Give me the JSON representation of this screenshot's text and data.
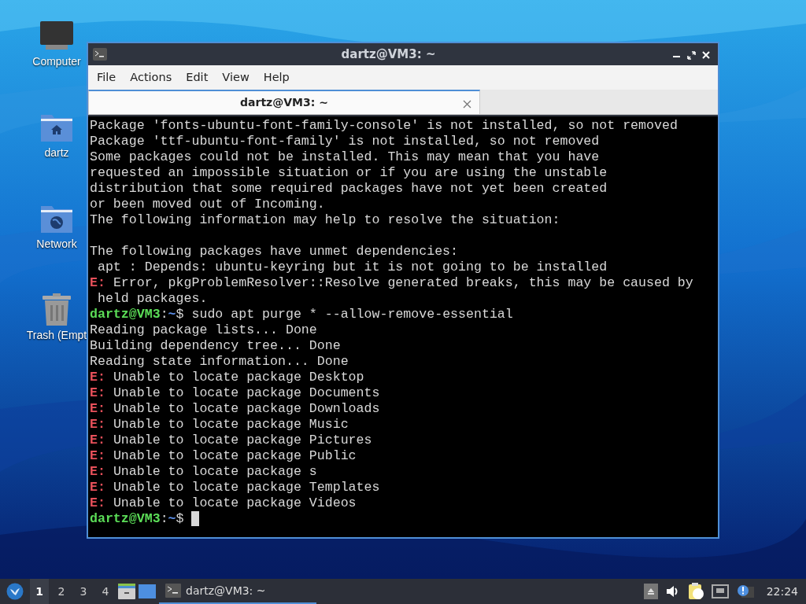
{
  "desktop": {
    "icons": [
      {
        "label": "Computer",
        "kind": "computer"
      },
      {
        "label": "dartz",
        "kind": "home"
      },
      {
        "label": "Network",
        "kind": "network"
      },
      {
        "label": "Trash (Empt",
        "kind": "trash"
      }
    ]
  },
  "window": {
    "title": "dartz@VM3: ~",
    "menu": [
      "File",
      "Actions",
      "Edit",
      "View",
      "Help"
    ],
    "tabs": [
      {
        "label": "dartz@VM3: ~",
        "selected": true
      }
    ],
    "terminal": {
      "lines": [
        {
          "kind": "text",
          "text": "Package 'fonts-ubuntu-font-family-console' is not installed, so not removed"
        },
        {
          "kind": "text",
          "text": "Package 'ttf-ubuntu-font-family' is not installed, so not removed"
        },
        {
          "kind": "text",
          "text": "Some packages could not be installed. This may mean that you have"
        },
        {
          "kind": "text",
          "text": "requested an impossible situation or if you are using the unstable"
        },
        {
          "kind": "text",
          "text": "distribution that some required packages have not yet been created"
        },
        {
          "kind": "text",
          "text": "or been moved out of Incoming."
        },
        {
          "kind": "text",
          "text": "The following information may help to resolve the situation:"
        },
        {
          "kind": "blank"
        },
        {
          "kind": "text",
          "text": "The following packages have unmet dependencies:"
        },
        {
          "kind": "text",
          "text": " apt : Depends: ubuntu-keyring but it is not going to be installed"
        },
        {
          "kind": "error",
          "prefix": "E:",
          "text": " Error, pkgProblemResolver::Resolve generated breaks, this may be caused by"
        },
        {
          "kind": "text",
          "text": " held packages."
        },
        {
          "kind": "prompt",
          "user": "dartz@VM3",
          "sep": ":",
          "path": "~",
          "symbol": "$",
          "command": "sudo apt purge * --allow-remove-essential",
          "cursor": false
        },
        {
          "kind": "text",
          "text": "Reading package lists... Done"
        },
        {
          "kind": "text",
          "text": "Building dependency tree... Done"
        },
        {
          "kind": "text",
          "text": "Reading state information... Done"
        },
        {
          "kind": "error",
          "prefix": "E:",
          "text": " Unable to locate package Desktop"
        },
        {
          "kind": "error",
          "prefix": "E:",
          "text": " Unable to locate package Documents"
        },
        {
          "kind": "error",
          "prefix": "E:",
          "text": " Unable to locate package Downloads"
        },
        {
          "kind": "error",
          "prefix": "E:",
          "text": " Unable to locate package Music"
        },
        {
          "kind": "error",
          "prefix": "E:",
          "text": " Unable to locate package Pictures"
        },
        {
          "kind": "error",
          "prefix": "E:",
          "text": " Unable to locate package Public"
        },
        {
          "kind": "error",
          "prefix": "E:",
          "text": " Unable to locate package s"
        },
        {
          "kind": "error",
          "prefix": "E:",
          "text": " Unable to locate package Templates"
        },
        {
          "kind": "error",
          "prefix": "E:",
          "text": " Unable to locate package Videos"
        },
        {
          "kind": "prompt",
          "user": "dartz@VM3",
          "sep": ":",
          "path": "~",
          "symbol": "$",
          "cursor": true
        }
      ]
    }
  },
  "taskbar": {
    "workspaces": [
      {
        "label": "1",
        "selected": true
      },
      {
        "label": "2",
        "selected": false
      },
      {
        "label": "3",
        "selected": false
      },
      {
        "label": "4",
        "selected": false
      }
    ],
    "tasks": [
      {
        "label": "dartz@VM3: ~",
        "selected": true
      }
    ],
    "clock": "22:24"
  }
}
